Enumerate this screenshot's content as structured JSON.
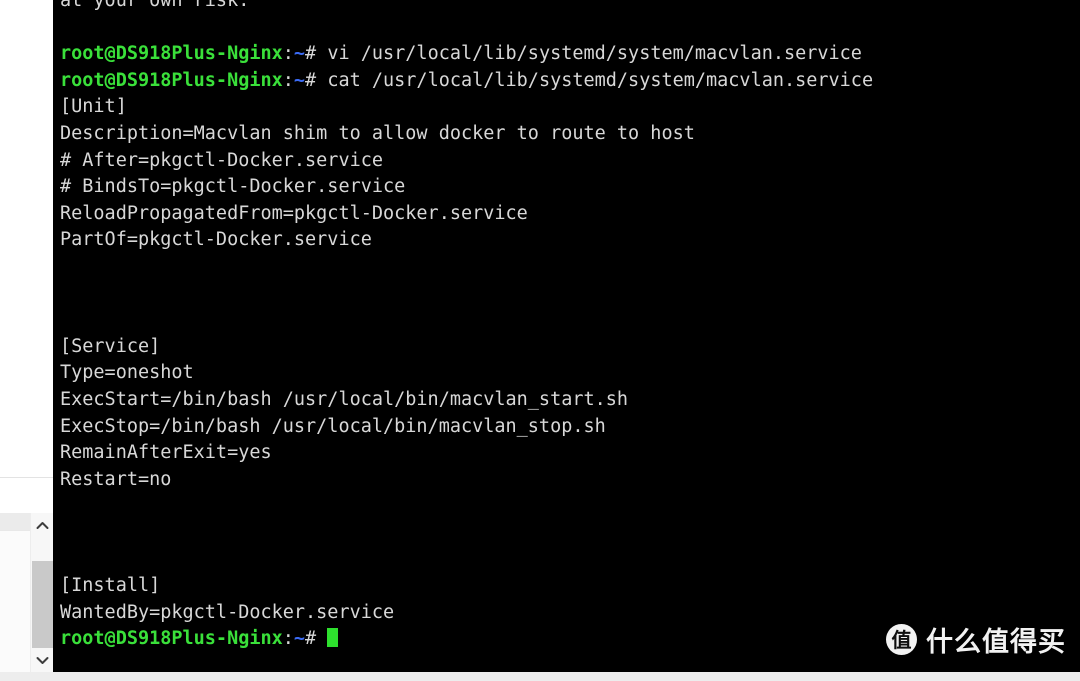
{
  "colors": {
    "terminal_background": "#000000",
    "terminal_foreground": "#d8d8d8",
    "prompt_green": "#3ae03a",
    "prompt_blue": "#3b6bf5",
    "cursor_green": "#2ee02e",
    "page_background": "#ffffff",
    "scrollbar_thumb": "#c9c9c9"
  },
  "terminal": {
    "lines": [
      {
        "type": "text",
        "text": "at your own risk."
      },
      {
        "type": "blank",
        "text": " "
      },
      {
        "type": "prompt",
        "user": "root@DS918Plus-Nginx",
        "colon": ":",
        "path": "~",
        "hash": "#",
        "command": " vi /usr/local/lib/systemd/system/macvlan.service"
      },
      {
        "type": "prompt",
        "user": "root@DS918Plus-Nginx",
        "colon": ":",
        "path": "~",
        "hash": "#",
        "command": " cat /usr/local/lib/systemd/system/macvlan.service"
      },
      {
        "type": "text",
        "text": "[Unit]"
      },
      {
        "type": "text",
        "text": "Description=Macvlan shim to allow docker to route to host"
      },
      {
        "type": "text",
        "text": "# After=pkgctl-Docker.service"
      },
      {
        "type": "text",
        "text": "# BindsTo=pkgctl-Docker.service"
      },
      {
        "type": "text",
        "text": "ReloadPropagatedFrom=pkgctl-Docker.service"
      },
      {
        "type": "text",
        "text": "PartOf=pkgctl-Docker.service"
      },
      {
        "type": "blank",
        "text": " "
      },
      {
        "type": "blank",
        "text": " "
      },
      {
        "type": "blank",
        "text": " "
      },
      {
        "type": "text",
        "text": "[Service]"
      },
      {
        "type": "text",
        "text": "Type=oneshot"
      },
      {
        "type": "text",
        "text": "ExecStart=/bin/bash /usr/local/bin/macvlan_start.sh"
      },
      {
        "type": "text",
        "text": "ExecStop=/bin/bash /usr/local/bin/macvlan_stop.sh"
      },
      {
        "type": "text",
        "text": "RemainAfterExit=yes"
      },
      {
        "type": "text",
        "text": "Restart=no"
      },
      {
        "type": "blank",
        "text": " "
      },
      {
        "type": "blank",
        "text": " "
      },
      {
        "type": "blank",
        "text": " "
      },
      {
        "type": "text",
        "text": "[Install]"
      },
      {
        "type": "text",
        "text": "WantedBy=pkgctl-Docker.service"
      },
      {
        "type": "prompt-cursor",
        "user": "root@DS918Plus-Nginx",
        "colon": ":",
        "path": "~",
        "hash": "#",
        "command": " "
      }
    ]
  },
  "scrollbar": {
    "up_arrow": "chevron-up-icon",
    "down_arrow": "chevron-down-icon"
  },
  "watermark": {
    "logo_char": "值",
    "text": "什么值得买"
  }
}
